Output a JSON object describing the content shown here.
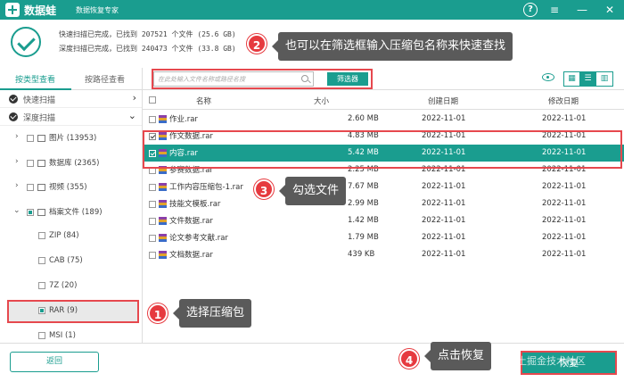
{
  "window": {
    "app_name": "数据蛙",
    "app_subtitle": "数据恢复专家",
    "help_label": "?",
    "menu_label": "≡",
    "minimize_label": "—",
    "close_label": "✕"
  },
  "status": {
    "quick_scan": "快速扫描已完成，已找到  207521 个文件 (25.6 GB)",
    "deep_scan": "深度扫描已完成，已找到  240473 个文件 (33.8 GB)"
  },
  "left_panel": {
    "tabs": [
      "按类型查看",
      "按路径查看"
    ],
    "scan_modes": [
      {
        "label": "快速扫描",
        "chevron": "›"
      },
      {
        "label": "深度扫描",
        "chevron": "⌄"
      }
    ],
    "tree": [
      {
        "label": "图片 (13953)",
        "arrow": "›"
      },
      {
        "label": "数据库 (2365)",
        "arrow": "›"
      },
      {
        "label": "视频 (355)",
        "arrow": "›"
      },
      {
        "label": "档案文件 (189)",
        "arrow": "⌄"
      },
      {
        "label": "ZIP (84)"
      },
      {
        "label": "CAB (75)"
      },
      {
        "label": "7Z (20)"
      },
      {
        "label": "RAR (9)"
      },
      {
        "label": "MSI (1)"
      }
    ]
  },
  "toolbar": {
    "search_placeholder": "在此处输入文件名称或路径名搜",
    "filter_button": "筛选器",
    "view_list_label": "☰",
    "view_grid_label": "▦",
    "view_detail_label": "▥"
  },
  "table": {
    "headers": [
      "名称",
      "大小",
      "创建日期",
      "修改日期"
    ],
    "rows": [
      {
        "name": "作业.rar",
        "size": "2.60 MB",
        "created": "2022-11-01",
        "modified": "2022-11-01",
        "checked": false,
        "selected": false
      },
      {
        "name": "作文数据.rar",
        "size": "4.83 MB",
        "created": "2022-11-01",
        "modified": "2022-11-01",
        "checked": true,
        "selected": false
      },
      {
        "name": "内容.rar",
        "size": "5.42 MB",
        "created": "2022-11-01",
        "modified": "2022-11-01",
        "checked": true,
        "selected": true
      },
      {
        "name": "参赛数据.rar",
        "size": "2.25 MB",
        "created": "2022-11-01",
        "modified": "2022-11-01",
        "checked": false,
        "selected": false
      },
      {
        "name": "工作内容压缩包-1.rar",
        "size": "7.67 MB",
        "created": "2022-11-01",
        "modified": "2022-11-01",
        "checked": false,
        "selected": false
      },
      {
        "name": "技能文模板.rar",
        "size": "2.99 MB",
        "created": "2022-11-01",
        "modified": "2022-11-01",
        "checked": false,
        "selected": false
      },
      {
        "name": "文件数据.rar",
        "size": "1.42 MB",
        "created": "2022-11-01",
        "modified": "2022-11-01",
        "checked": false,
        "selected": false
      },
      {
        "name": "论文参考文献.rar",
        "size": "1.79 MB",
        "created": "2022-11-01",
        "modified": "2022-11-01",
        "checked": false,
        "selected": false
      },
      {
        "name": "文档数据.rar",
        "size": "439 KB",
        "created": "2022-11-01",
        "modified": "2022-11-01",
        "checked": false,
        "selected": false
      }
    ]
  },
  "bottom": {
    "back_button": "返回",
    "recover_button": "恢复",
    "watermark": "@稀土掘金技术社区"
  },
  "annotations": [
    {
      "number": "1",
      "text": "选择压缩包"
    },
    {
      "number": "2",
      "text": "也可以在筛选框输入压缩包名称来快速查找"
    },
    {
      "number": "3",
      "text": "勾选文件"
    },
    {
      "number": "4",
      "text": "点击恢复"
    }
  ],
  "colors": {
    "accent": "#1a9d8f",
    "highlight": "#e6484e",
    "callout": "#5a5a5a"
  }
}
